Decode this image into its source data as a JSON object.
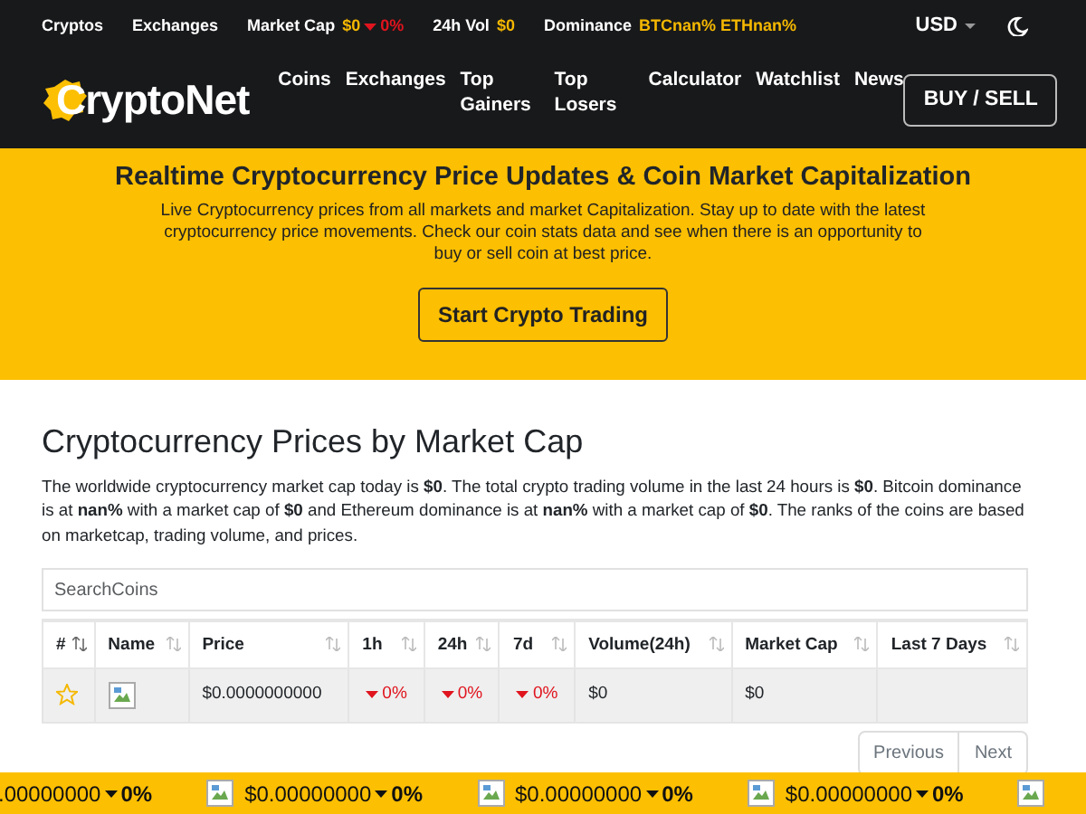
{
  "top_bar": {
    "links": [
      "Cryptos",
      "Exchanges"
    ],
    "stats": [
      {
        "label": "Market Cap",
        "value": "$0",
        "change": "0%",
        "falling": true
      },
      {
        "label": "24h Vol",
        "value": "$0"
      },
      {
        "label": "Dominance",
        "value": "BTCnan% ETHnan%"
      }
    ],
    "currency": "USD"
  },
  "navbar": {
    "brand": "CryptoNet",
    "links": [
      "Coins",
      "Exchanges",
      "Top Gainers",
      "Top Losers",
      "Calculator",
      "Watchlist",
      "News"
    ],
    "action": "BUY / SELL"
  },
  "hero": {
    "title": "Realtime Cryptocurrency Price Updates & Coin Market Capitalization",
    "text": "Live Cryptocurrency prices from all markets and market Capitalization. Stay up to date with the latest cryptocurrency price movements. Check our coin stats data and see when there is an opportunity to buy or sell coin at best price.",
    "button": "Start Crypto Trading"
  },
  "prices": {
    "title": "Cryptocurrency Prices by Market Cap",
    "text": "The worldwide cryptocurrency market cap today is **$0**. The total crypto trading volume in the last 24 hours is **$0**. Bitcoin dominance is at **nan%** with a market cap of **$0** and Ethereum dominance is at **nan%** with a market cap of **$0**. The ranks of the coins are based on marketcap, trading volume, and prices.",
    "search": {
      "placeholder": "SearchCoins"
    },
    "table": {
      "columns": [
        "#",
        "Name",
        "Price",
        "1h",
        "24h",
        "7d",
        "Volume(24h)",
        "Market Cap",
        "Last 7 Days"
      ],
      "rows": [
        {
          "starred": false,
          "price": "$0.0000000000",
          "h1": "0%",
          "h24": "0%",
          "d7": "0%",
          "falling": true,
          "volume": "$0",
          "market_cap": "$0"
        }
      ]
    },
    "pagination": [
      "Previous",
      "Next"
    ]
  },
  "ticker": [
    {
      "image": false,
      "price": ".00000000",
      "change": "0%",
      "falling": true
    },
    {
      "image": true,
      "price": "$0.00000000",
      "change": "0%",
      "falling": true
    },
    {
      "image": true,
      "price": "$0.00000000",
      "change": "0%",
      "falling": true
    },
    {
      "image": true,
      "price": "$0.00000000",
      "change": "0%",
      "falling": true
    },
    {
      "image": true
    }
  ]
}
